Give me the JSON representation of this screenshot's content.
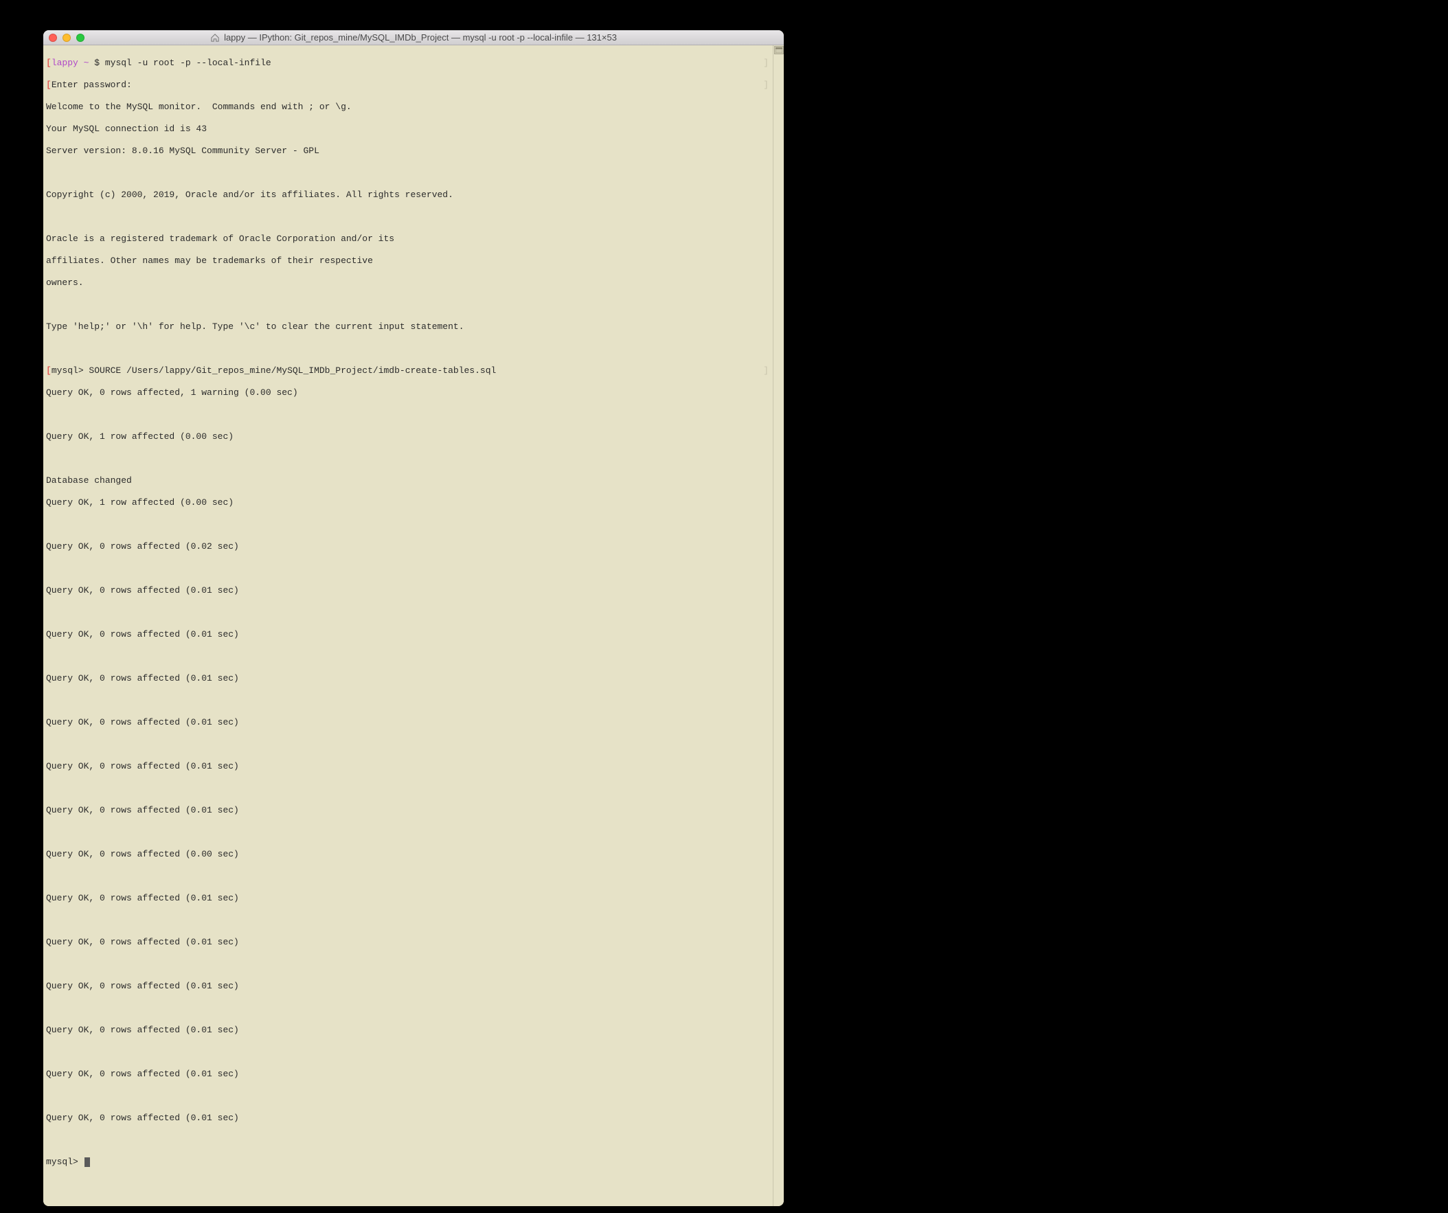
{
  "window": {
    "title": "lappy — IPython: Git_repos_mine/MySQL_IMDb_Project — mysql -u root -p --local-infile — 131×53"
  },
  "prompt": {
    "lbracket": "[",
    "user_host": "lappy ~ ",
    "dollar": "$",
    "command": " mysql -u root -p --local-infile",
    "rbracket": "]"
  },
  "lines": {
    "l2": "Enter password:",
    "l3": "Welcome to the MySQL monitor.  Commands end with ; or \\g.",
    "l4": "Your MySQL connection id is 43",
    "l5": "Server version: 8.0.16 MySQL Community Server - GPL",
    "l6": "",
    "l7": "Copyright (c) 2000, 2019, Oracle and/or its affiliates. All rights reserved.",
    "l8": "",
    "l9": "Oracle is a registered trademark of Oracle Corporation and/or its",
    "l10": "affiliates. Other names may be trademarks of their respective",
    "l11": "owners.",
    "l12": "",
    "l13": "Type 'help;' or '\\h' for help. Type '\\c' to clear the current input statement.",
    "l14": ""
  },
  "source": {
    "lbracket": "[",
    "prompt": "mysql> ",
    "cmd": "SOURCE /Users/lappy/Git_repos_mine/MySQL_IMDb_Project/imdb-create-tables.sql",
    "rbracket": "]"
  },
  "results": {
    "r1": "Query OK, 0 rows affected, 1 warning (0.00 sec)",
    "b1": "",
    "r2": "Query OK, 1 row affected (0.00 sec)",
    "b2": "",
    "r3": "Database changed",
    "r4": "Query OK, 1 row affected (0.00 sec)",
    "b3": "",
    "r5": "Query OK, 0 rows affected (0.02 sec)",
    "b4": "",
    "r6": "Query OK, 0 rows affected (0.01 sec)",
    "b5": "",
    "r7": "Query OK, 0 rows affected (0.01 sec)",
    "b6": "",
    "r8": "Query OK, 0 rows affected (0.01 sec)",
    "b7": "",
    "r9": "Query OK, 0 rows affected (0.01 sec)",
    "b8": "",
    "r10": "Query OK, 0 rows affected (0.01 sec)",
    "b9": "",
    "r11": "Query OK, 0 rows affected (0.01 sec)",
    "b10": "",
    "r12": "Query OK, 0 rows affected (0.00 sec)",
    "b11": "",
    "r13": "Query OK, 0 rows affected (0.01 sec)",
    "b12": "",
    "r14": "Query OK, 0 rows affected (0.01 sec)",
    "b13": "",
    "r15": "Query OK, 0 rows affected (0.01 sec)",
    "b14": "",
    "r16": "Query OK, 0 rows affected (0.01 sec)",
    "b15": "",
    "r17": "Query OK, 0 rows affected (0.01 sec)",
    "b16": "",
    "r18": "Query OK, 0 rows affected (0.01 sec)",
    "b17": ""
  },
  "final_prompt": "mysql> "
}
